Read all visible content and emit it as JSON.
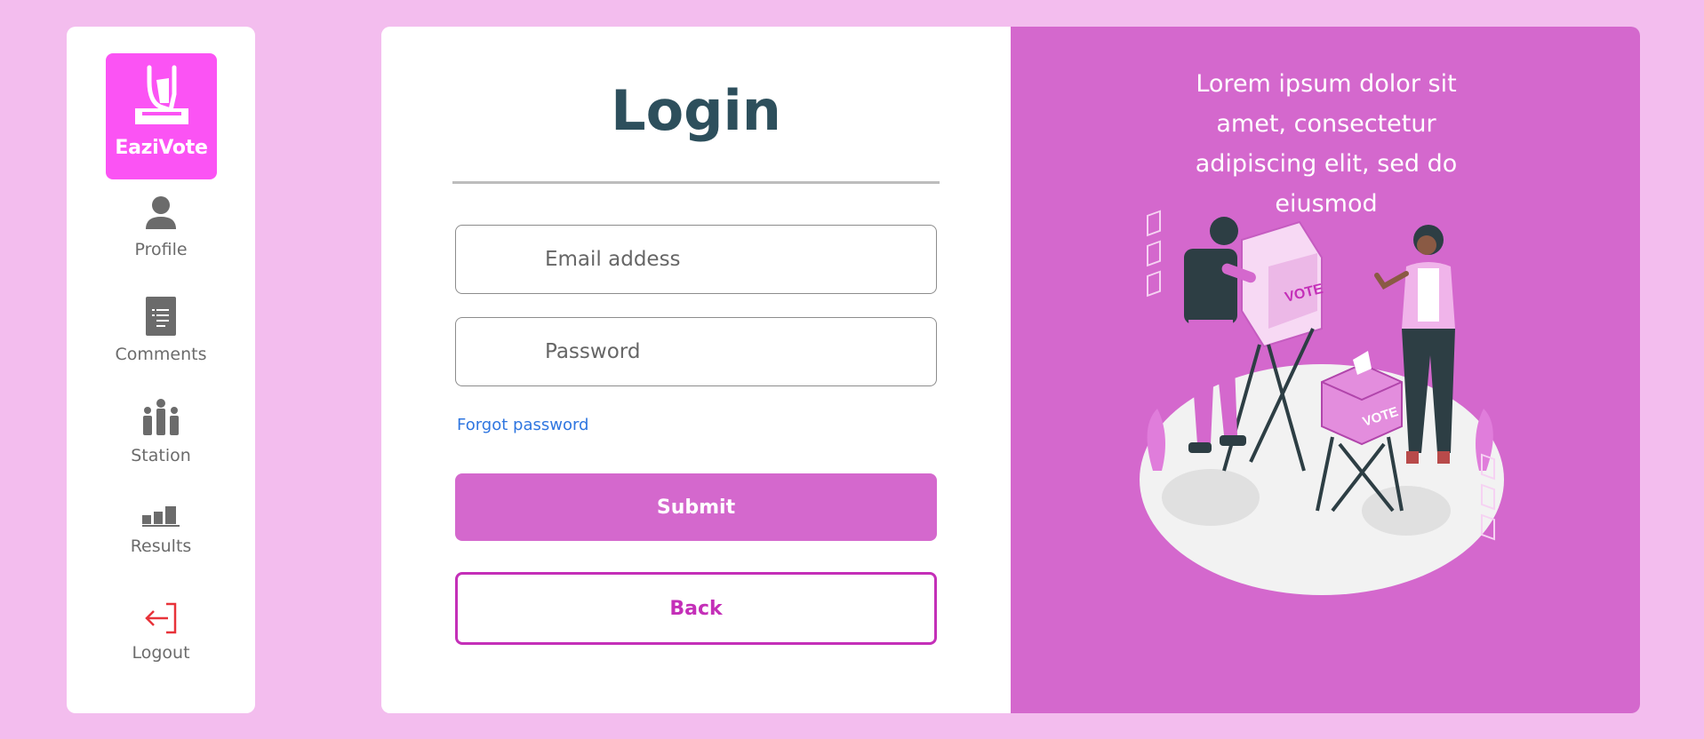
{
  "app": {
    "name": "EaziVote"
  },
  "sidebar": {
    "items": [
      {
        "label": "Profile",
        "icon": "user-icon"
      },
      {
        "label": "Comments",
        "icon": "document-icon"
      },
      {
        "label": "Station",
        "icon": "people-icon"
      },
      {
        "label": "Results",
        "icon": "bar-chart-icon"
      },
      {
        "label": "Logout",
        "icon": "logout-icon"
      }
    ]
  },
  "login": {
    "title": "Login",
    "email_placeholder": "Email addess",
    "password_placeholder": "Password",
    "forgot_label": "Forgot password",
    "submit_label": "Submit",
    "back_label": "Back"
  },
  "art": {
    "blurb": "Lorem ipsum dolor sit amet, consectetur adipiscing elit, sed do eiusmod",
    "illustration": "voting-booth-illustration"
  },
  "colors": {
    "background": "#f3bdee",
    "accent": "#d468cd",
    "logo": "#fb53f4",
    "back_border": "#c42fb8",
    "link": "#2f76e0",
    "title": "#2d4f5c",
    "logout_icon": "#e8333a"
  }
}
